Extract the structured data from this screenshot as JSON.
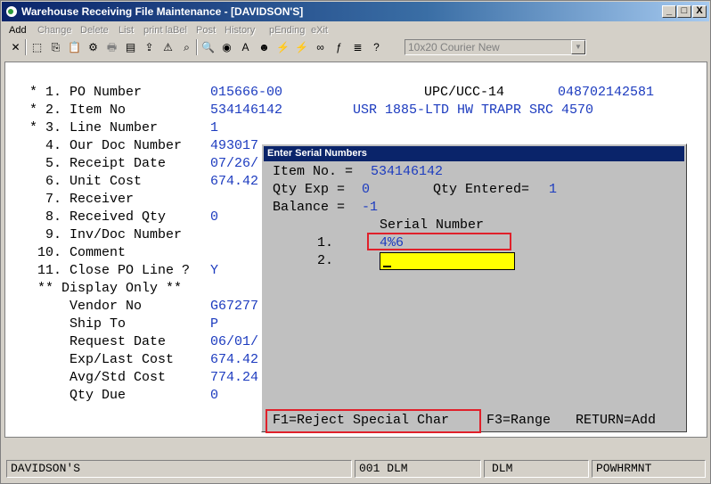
{
  "window": {
    "title": "Warehouse Receiving File Maintenance - [DAVIDSON'S]"
  },
  "title_buttons": {
    "minimize": "_",
    "maximize": "□",
    "close": "X"
  },
  "menu": [
    {
      "label": "Add",
      "enabled": true
    },
    {
      "label": "Change",
      "enabled": false
    },
    {
      "label": "Delete",
      "enabled": false
    },
    {
      "label": "List",
      "enabled": false
    },
    {
      "label": "print laBel",
      "enabled": false
    },
    {
      "label": "Post",
      "enabled": false
    },
    {
      "label": "History",
      "enabled": false
    },
    {
      "label": "pEnding",
      "enabled": false
    },
    {
      "label": "eXit",
      "enabled": false
    }
  ],
  "toolbar": {
    "icons": [
      {
        "name": "close-tool-icon",
        "glyph": "✕",
        "dim": false
      },
      {
        "name": "select-tool-icon",
        "glyph": "⬚",
        "dim": false
      },
      {
        "name": "copy-tool-icon",
        "glyph": "⎘",
        "dim": false
      },
      {
        "name": "paste-tool-icon",
        "glyph": "📋",
        "dim": false
      },
      {
        "name": "settings-tool-icon",
        "glyph": "⚙",
        "dim": false
      },
      {
        "name": "print-tool-icon",
        "glyph": "🖶",
        "dim": true
      },
      {
        "name": "note-tool-icon",
        "glyph": "▤",
        "dim": false
      },
      {
        "name": "export-tool-icon",
        "glyph": "⇪",
        "dim": false
      },
      {
        "name": "warning-tool-icon",
        "glyph": "⚠",
        "dim": false
      },
      {
        "name": "binoculars-tool-icon",
        "glyph": "⌕",
        "dim": false
      },
      {
        "name": "search-tool-icon",
        "glyph": "🔍",
        "dim": true
      },
      {
        "name": "web-tool-icon",
        "glyph": "◉",
        "dim": false
      },
      {
        "name": "font-tool-icon",
        "glyph": "A",
        "dim": false
      },
      {
        "name": "user-tool-icon",
        "glyph": "☻",
        "dim": false
      },
      {
        "name": "flash-tool-icon",
        "glyph": "⚡",
        "dim": false
      },
      {
        "name": "run-tool-icon",
        "glyph": "⚡",
        "dim": false
      },
      {
        "name": "link-tool-icon",
        "glyph": "∞",
        "dim": false
      },
      {
        "name": "function-tool-icon",
        "glyph": "ƒ",
        "dim": false
      },
      {
        "name": "list-tool-icon",
        "glyph": "≣",
        "dim": false
      },
      {
        "name": "help-tool-icon",
        "glyph": "?",
        "dim": false
      }
    ],
    "font_combo": "10x20 Courier New"
  },
  "form": {
    "fields": [
      {
        "label": " * 1. PO Number       ",
        "value": "015666-00"
      },
      {
        "label": " * 2. Item No         ",
        "value": "534146142"
      },
      {
        "label": " * 3. Line Number     ",
        "value": "1"
      },
      {
        "label": "   4. Our Doc Number  ",
        "value": "493017"
      },
      {
        "label": "   5. Receipt Date    ",
        "value": "07/26/"
      },
      {
        "label": "   6. Unit Cost       ",
        "value": "674.42"
      },
      {
        "label": "   7. Receiver        ",
        "value": ""
      },
      {
        "label": "   8. Received Qty    ",
        "value": "0"
      },
      {
        "label": "   9. Inv/Doc Number  ",
        "value": ""
      },
      {
        "label": "  10. Comment         ",
        "value": ""
      },
      {
        "label": "  11. Close PO Line ? ",
        "value": "Y"
      },
      {
        "label": "  ** Display Only **  ",
        "value": ""
      },
      {
        "label": "      Vendor No       ",
        "value": "G67277"
      },
      {
        "label": "      Ship To         ",
        "value": "P"
      },
      {
        "label": "      Request Date    ",
        "value": "06/01/"
      },
      {
        "label": "      Exp/Last Cost   ",
        "value": "674.42"
      },
      {
        "label": "      Avg/Std Cost    ",
        "value": "774.24"
      },
      {
        "label": "      Qty Due         ",
        "value": "0"
      }
    ],
    "upc_label": "UPC/UCC-14",
    "upc_value": "048702142581",
    "item_desc": "USR 1885-LTD HW TRAPR SRC 4570"
  },
  "dialog": {
    "title": "Enter Serial Numbers",
    "item_label": "Item No. = ",
    "item_value": "534146142",
    "qty_exp_label": "Qty Exp = ",
    "qty_exp_value": "0",
    "qty_entered_label": "Qty Entered= ",
    "qty_entered_value": "1",
    "balance_label": "Balance = ",
    "balance_value": "-1",
    "serial_header": "Serial Number",
    "row1_num": "1.",
    "row1_value": "4%6",
    "row2_num": "2.",
    "row2_value": "",
    "footer_f1": "F1=Reject Special Char",
    "footer_f3": "F3=Range",
    "footer_return": "RETURN=Add"
  },
  "status": {
    "company": "DAVIDSON'S",
    "user": "001 DLM",
    "user2": "DLM",
    "program": "POWHRMNT"
  },
  "colors": {
    "label": "#000000",
    "value": "#1c3bbf",
    "highlight": "#e0202a",
    "input_bg": "#ffff00",
    "title_blue": "#0a246a"
  }
}
